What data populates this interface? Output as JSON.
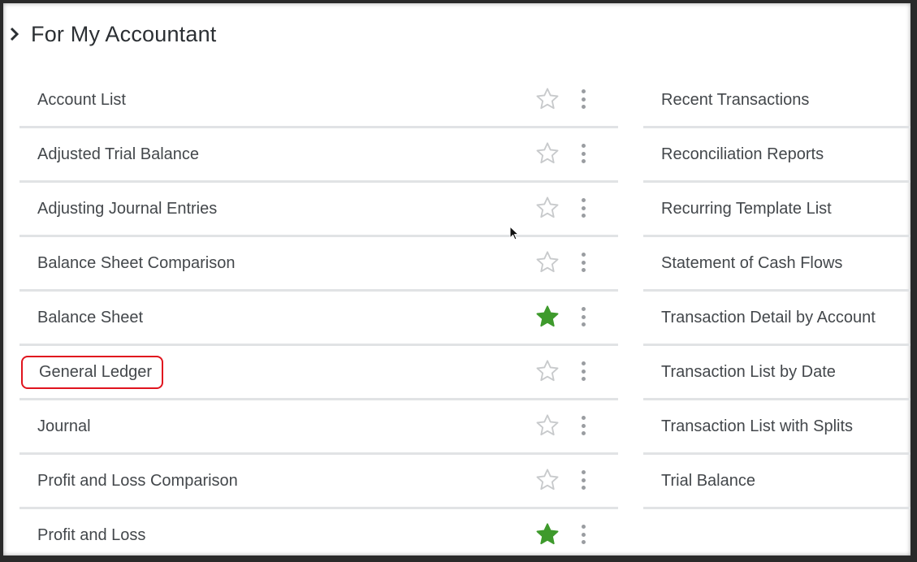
{
  "section": {
    "title": "For My Accountant",
    "expand_icon": "chevron-right-icon"
  },
  "colors": {
    "favorite_star": "#3e9a2c",
    "unfavorite_star": "#c8cacc",
    "highlight_border": "#e0141e"
  },
  "left_reports": [
    {
      "label": "Account List",
      "favorite": false
    },
    {
      "label": "Adjusted Trial Balance",
      "favorite": false
    },
    {
      "label": "Adjusting Journal Entries",
      "favorite": false
    },
    {
      "label": "Balance Sheet Comparison",
      "favorite": false
    },
    {
      "label": "Balance Sheet",
      "favorite": true
    },
    {
      "label": "General Ledger",
      "favorite": false,
      "highlighted": true
    },
    {
      "label": "Journal",
      "favorite": false
    },
    {
      "label": "Profit and Loss Comparison",
      "favorite": false
    },
    {
      "label": "Profit and Loss",
      "favorite": true
    }
  ],
  "right_reports": [
    {
      "label": "Recent Transactions"
    },
    {
      "label": "Reconciliation Reports"
    },
    {
      "label": "Recurring Template List"
    },
    {
      "label": "Statement of Cash Flows"
    },
    {
      "label": "Transaction Detail by Account"
    },
    {
      "label": "Transaction List by Date"
    },
    {
      "label": "Transaction List with Splits"
    },
    {
      "label": "Trial Balance"
    }
  ]
}
